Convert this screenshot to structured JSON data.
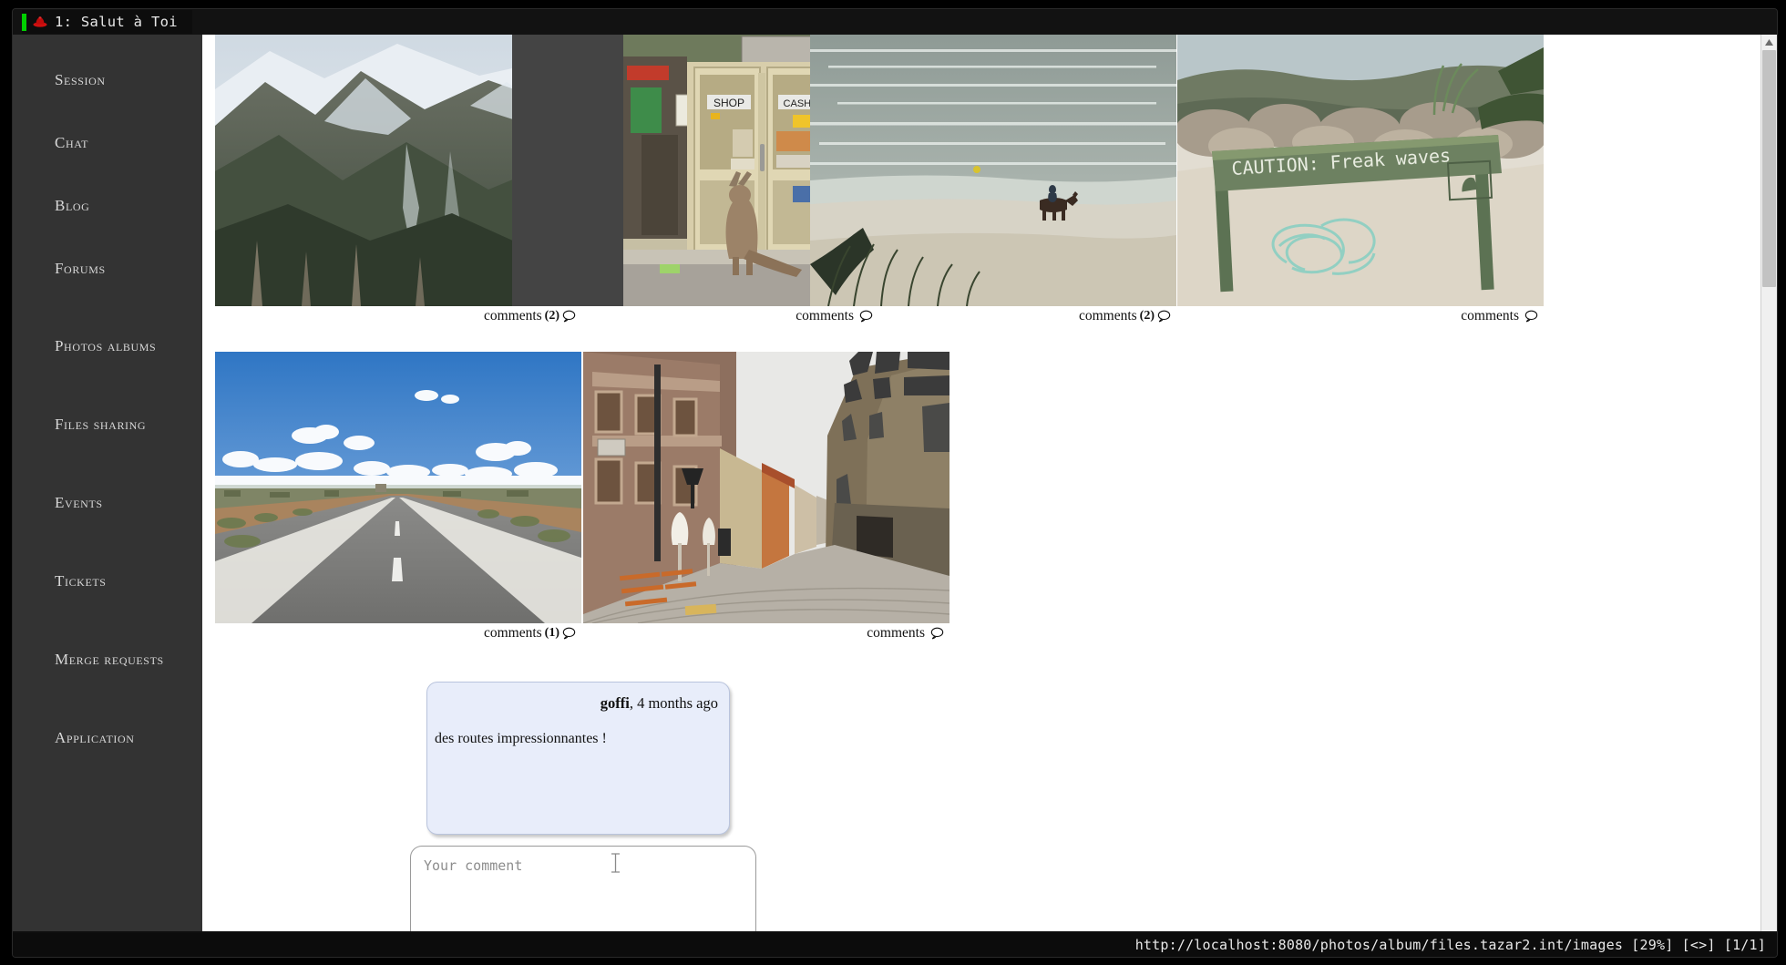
{
  "window": {
    "tab": {
      "index_label": "1: Salut à Toi",
      "favicon": "red-hat-icon",
      "active_indicator_color": "#00d000"
    }
  },
  "sidebar": {
    "background": "#333333",
    "items": [
      {
        "label": "Session",
        "name": "sidebar-item-session"
      },
      {
        "label": "Chat",
        "name": "sidebar-item-chat"
      },
      {
        "label": "Blog",
        "name": "sidebar-item-blog"
      },
      {
        "label": "Forums",
        "name": "sidebar-item-forums"
      },
      {
        "label": "Photos albums",
        "name": "sidebar-item-photos-albums"
      },
      {
        "label": "Files sharing",
        "name": "sidebar-item-files-sharing"
      },
      {
        "label": "Events",
        "name": "sidebar-item-events"
      },
      {
        "label": "Tickets",
        "name": "sidebar-item-tickets"
      },
      {
        "label": "Merge requests",
        "name": "sidebar-item-merge-requests"
      },
      {
        "label": "Application",
        "name": "sidebar-item-application"
      }
    ]
  },
  "gallery": {
    "photos": [
      {
        "alt": "Snow-capped mountain ridge with glacier and dead trees",
        "comments_label": "comments",
        "comments_count": "(2)",
        "layout": "wide"
      },
      {
        "alt": "Kangaroo standing in front of a shop with SHOP and CASHIER signs",
        "comments_label": "comments",
        "comments_count": "",
        "layout": "narrow"
      },
      {
        "alt": "Horse rider on a beach by the sea with dune grass",
        "comments_label": "comments",
        "comments_count": "(2)",
        "layout": "wide"
      },
      {
        "alt": "Green sign reading CAUTION: Freak waves on a sandy beach with rope",
        "comments_label": "comments",
        "comments_count": "",
        "layout": "wide"
      },
      {
        "alt": "Straight outback road under blue sky with clouds",
        "comments_label": "comments",
        "comments_count": "(1)",
        "layout": "wide"
      },
      {
        "alt": "Cobblestone street beside a gothic cathedral",
        "comments_label": "comments",
        "comments_count": "",
        "layout": "wide"
      }
    ]
  },
  "comment_thread": {
    "comments": [
      {
        "author": "goffi",
        "timestamp": ", 4 months ago",
        "text": "des routes impressionnantes !"
      }
    ],
    "input": {
      "placeholder": "Your comment",
      "value": ""
    }
  },
  "statusbar": {
    "url": "http://localhost:8080/photos/album/files.tazar2.int/images [29%] [<>] [1/1]"
  },
  "scrollbar": {
    "arrow": "scroll-up-arrow-icon"
  }
}
